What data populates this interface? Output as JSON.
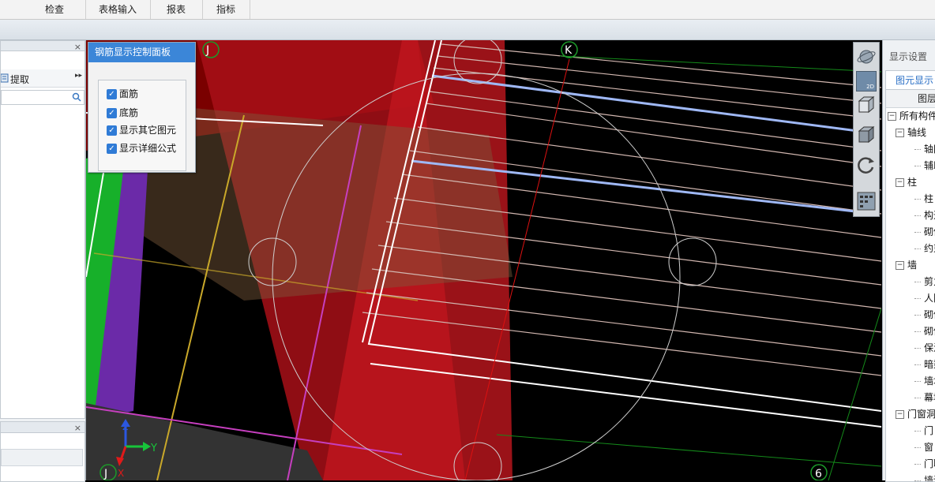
{
  "menu": [
    "检查",
    "表格输入",
    "报表",
    "指标"
  ],
  "left_panel": {
    "close_top": "×",
    "extract_label": "提取",
    "expand_glyph": "▸▸",
    "close_bottom": "×"
  },
  "rebar_panel": {
    "title": "钢筋显示控制面板",
    "checks": [
      "面筋",
      "底筋",
      "显示其它图元",
      "显示详细公式"
    ]
  },
  "view_toolbar": {
    "mode_2d": "2D"
  },
  "axis_labels": {
    "j_top": "J",
    "k_top": "K",
    "j_bottom": "J",
    "six": "6"
  },
  "gizmo": {
    "x": "X",
    "y": "Y",
    "z": "Z"
  },
  "right_panel": {
    "title": "显示设置",
    "tab": "图元显示",
    "header": "图层",
    "tree": [
      {
        "label": "所有构件",
        "level": 0,
        "toggle": "−"
      },
      {
        "label": "轴线",
        "level": 1,
        "toggle": "−"
      },
      {
        "label": "轴网",
        "level": 2,
        "toggle": ""
      },
      {
        "label": "辅助",
        "level": 2,
        "toggle": ""
      },
      {
        "label": "柱",
        "level": 1,
        "toggle": "−"
      },
      {
        "label": "柱",
        "level": 2,
        "toggle": ""
      },
      {
        "label": "构造",
        "level": 2,
        "toggle": ""
      },
      {
        "label": "砌体",
        "level": 2,
        "toggle": ""
      },
      {
        "label": "约束",
        "level": 2,
        "toggle": ""
      },
      {
        "label": "墙",
        "level": 1,
        "toggle": "−"
      },
      {
        "label": "剪力",
        "level": 2,
        "toggle": ""
      },
      {
        "label": "人防",
        "level": 2,
        "toggle": ""
      },
      {
        "label": "砌体",
        "level": 2,
        "toggle": ""
      },
      {
        "label": "砌体",
        "level": 2,
        "toggle": ""
      },
      {
        "label": "保温",
        "level": 2,
        "toggle": ""
      },
      {
        "label": "暗梁",
        "level": 2,
        "toggle": ""
      },
      {
        "label": "墙垛",
        "level": 2,
        "toggle": ""
      },
      {
        "label": "幕墙",
        "level": 2,
        "toggle": ""
      },
      {
        "label": "门窗洞",
        "level": 1,
        "toggle": "−"
      },
      {
        "label": "门",
        "level": 2,
        "toggle": ""
      },
      {
        "label": "窗",
        "level": 2,
        "toggle": ""
      },
      {
        "label": "门联",
        "level": 2,
        "toggle": ""
      },
      {
        "label": "墙洞",
        "level": 2,
        "toggle": ""
      }
    ]
  }
}
